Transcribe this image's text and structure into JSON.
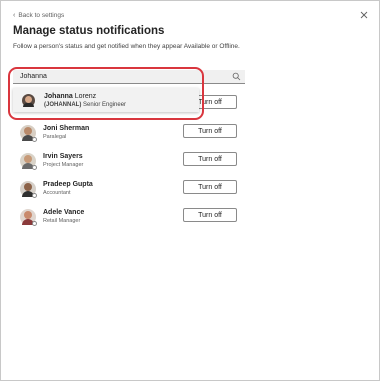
{
  "header": {
    "back_label": "Back to settings",
    "title": "Manage status notifications",
    "subtitle": "Follow a person's status and get notified when they appear Available or Offline."
  },
  "search": {
    "value": "Johanna",
    "placeholder": ""
  },
  "suggestion": {
    "name_match": "Johanna",
    "name_rest": " Lorenz",
    "alias": "(JOHANNAL)",
    "title": " Senior Engineer"
  },
  "people": [
    {
      "name": "",
      "role": "",
      "button_label": "Turn off"
    },
    {
      "name": "Joni Sherman",
      "role": "Paralegal",
      "button_label": "Turn off"
    },
    {
      "name": "Irvin Sayers",
      "role": "Project Manager",
      "button_label": "Turn off"
    },
    {
      "name": "Pradeep Gupta",
      "role": "Accountant",
      "button_label": "Turn off"
    },
    {
      "name": "Adele Vance",
      "role": "Retail Manager",
      "button_label": "Turn off"
    }
  ],
  "colors": {
    "highlight_ring": "#d9363e",
    "search_background": "#f0f0f0"
  },
  "icons": {
    "back": "chevron-left-icon",
    "close": "close-icon",
    "search": "search-icon"
  }
}
